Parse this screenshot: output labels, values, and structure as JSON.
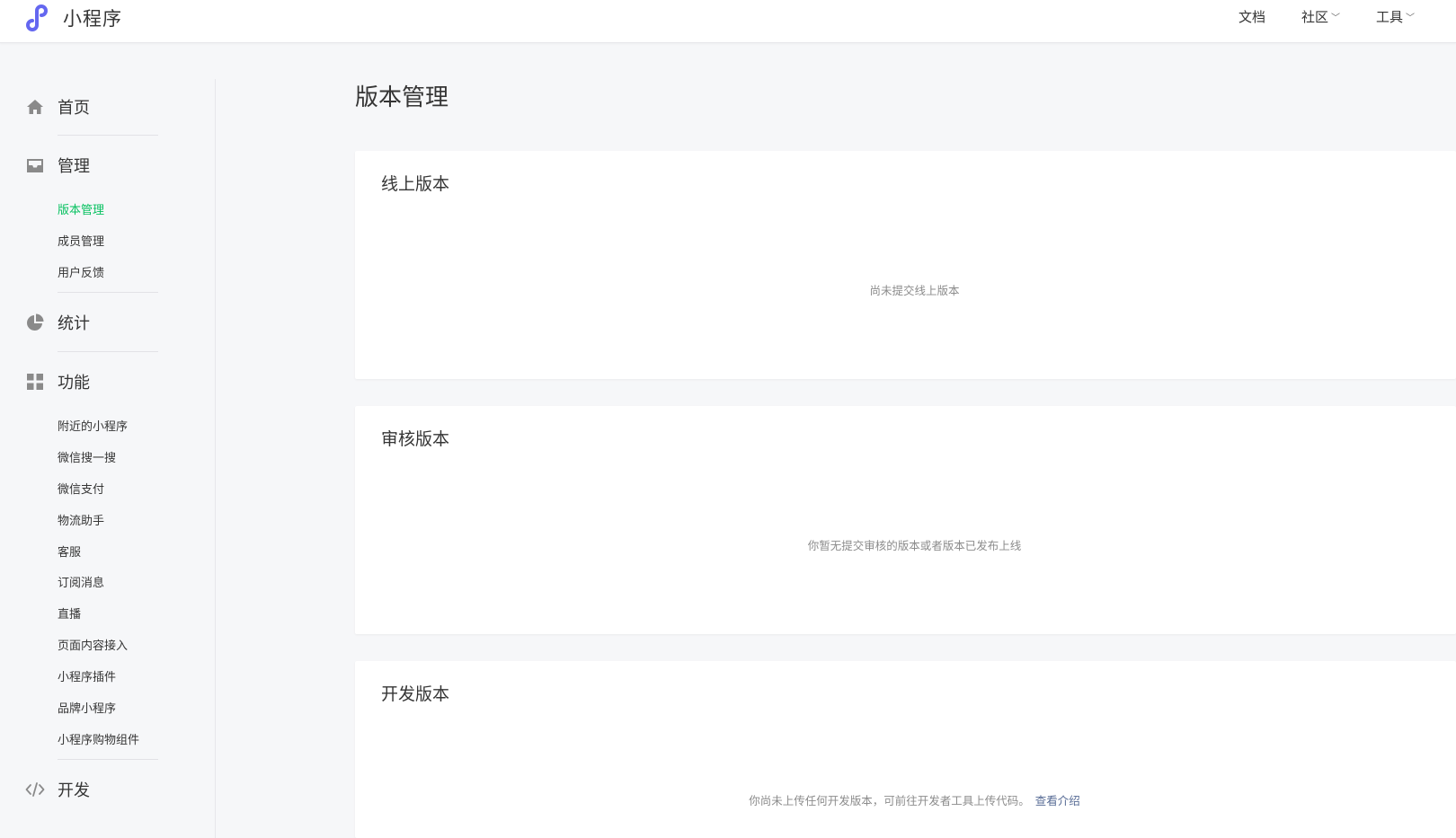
{
  "header": {
    "logo_text": "小程序",
    "nav": [
      {
        "label": "文档",
        "has_dropdown": false
      },
      {
        "label": "社区",
        "has_dropdown": true
      },
      {
        "label": "工具",
        "has_dropdown": true
      }
    ]
  },
  "sidebar": {
    "home": {
      "label": "首页",
      "icon": "home-icon"
    },
    "manage": {
      "label": "管理",
      "icon": "inbox-icon",
      "items": [
        {
          "label": "版本管理",
          "active": true
        },
        {
          "label": "成员管理",
          "active": false
        },
        {
          "label": "用户反馈",
          "active": false
        }
      ]
    },
    "stats": {
      "label": "统计",
      "icon": "pie-chart-icon"
    },
    "features": {
      "label": "功能",
      "icon": "grid-icon",
      "items": [
        {
          "label": "附近的小程序"
        },
        {
          "label": "微信搜一搜"
        },
        {
          "label": "微信支付"
        },
        {
          "label": "物流助手"
        },
        {
          "label": "客服"
        },
        {
          "label": "订阅消息"
        },
        {
          "label": "直播"
        },
        {
          "label": "页面内容接入"
        },
        {
          "label": "小程序插件"
        },
        {
          "label": "品牌小程序"
        },
        {
          "label": "小程序购物组件"
        }
      ]
    },
    "develop": {
      "label": "开发",
      "icon": "code-icon"
    }
  },
  "main": {
    "title": "版本管理",
    "sections": [
      {
        "title": "线上版本",
        "empty_text": "尚未提交线上版本"
      },
      {
        "title": "审核版本",
        "empty_text": "你暂无提交审核的版本或者版本已发布上线"
      },
      {
        "title": "开发版本",
        "empty_text": "你尚未上传任何开发版本，可前往开发者工具上传代码。",
        "link_text": "查看介绍"
      }
    ]
  },
  "colors": {
    "accent_green": "#07c160",
    "link_blue": "#576b95",
    "logo_purple": "#6467f0",
    "background": "#f6f7f9"
  }
}
